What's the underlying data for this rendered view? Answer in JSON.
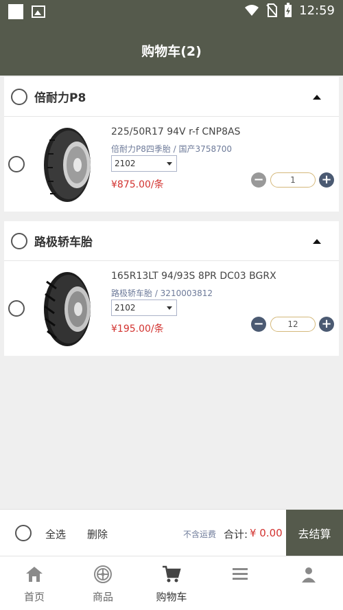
{
  "status_bar": {
    "time": "12:59"
  },
  "header": {
    "title": "购物车(2)"
  },
  "cart": {
    "groups": [
      {
        "store": "倍耐力P8",
        "items": [
          {
            "name": "225/50R17 94V r-f CNP8AS",
            "spec": "倍耐力P8四季胎 / 国产3758700",
            "option": "2102",
            "price": "¥875.00/条",
            "quantity": "1",
            "minus_label": "−",
            "plus_label": "+"
          }
        ]
      },
      {
        "store": "路极轿车胎",
        "items": [
          {
            "name": "165R13LT 94/93S 8PR DC03 BGRX",
            "spec": "路极轿车胎 / 3210003812",
            "option": "2102",
            "price": "¥195.00/条",
            "quantity": "12",
            "minus_label": "−",
            "plus_label": "+"
          }
        ]
      }
    ]
  },
  "checkout": {
    "select_all": "全选",
    "delete": "删除",
    "shipping_note": "不含运费",
    "total_label": "合计:",
    "total_value": "¥ 0.00",
    "button": "去结算"
  },
  "tabbar": {
    "tabs": [
      {
        "label": "首页",
        "icon": "home-icon"
      },
      {
        "label": "商品",
        "icon": "tire-icon"
      },
      {
        "label": "购物车",
        "icon": "cart-icon",
        "active": true
      },
      {
        "label": "",
        "icon": "menu-icon"
      },
      {
        "label": "",
        "icon": "user-icon"
      }
    ]
  },
  "colors": {
    "header_bg": "#555a4c",
    "price": "#d2322f",
    "spec_text": "#6d7a99",
    "stepper_active": "#4b5a72",
    "stepper_disabled": "#999999",
    "qty_border": "#d4b87a"
  }
}
